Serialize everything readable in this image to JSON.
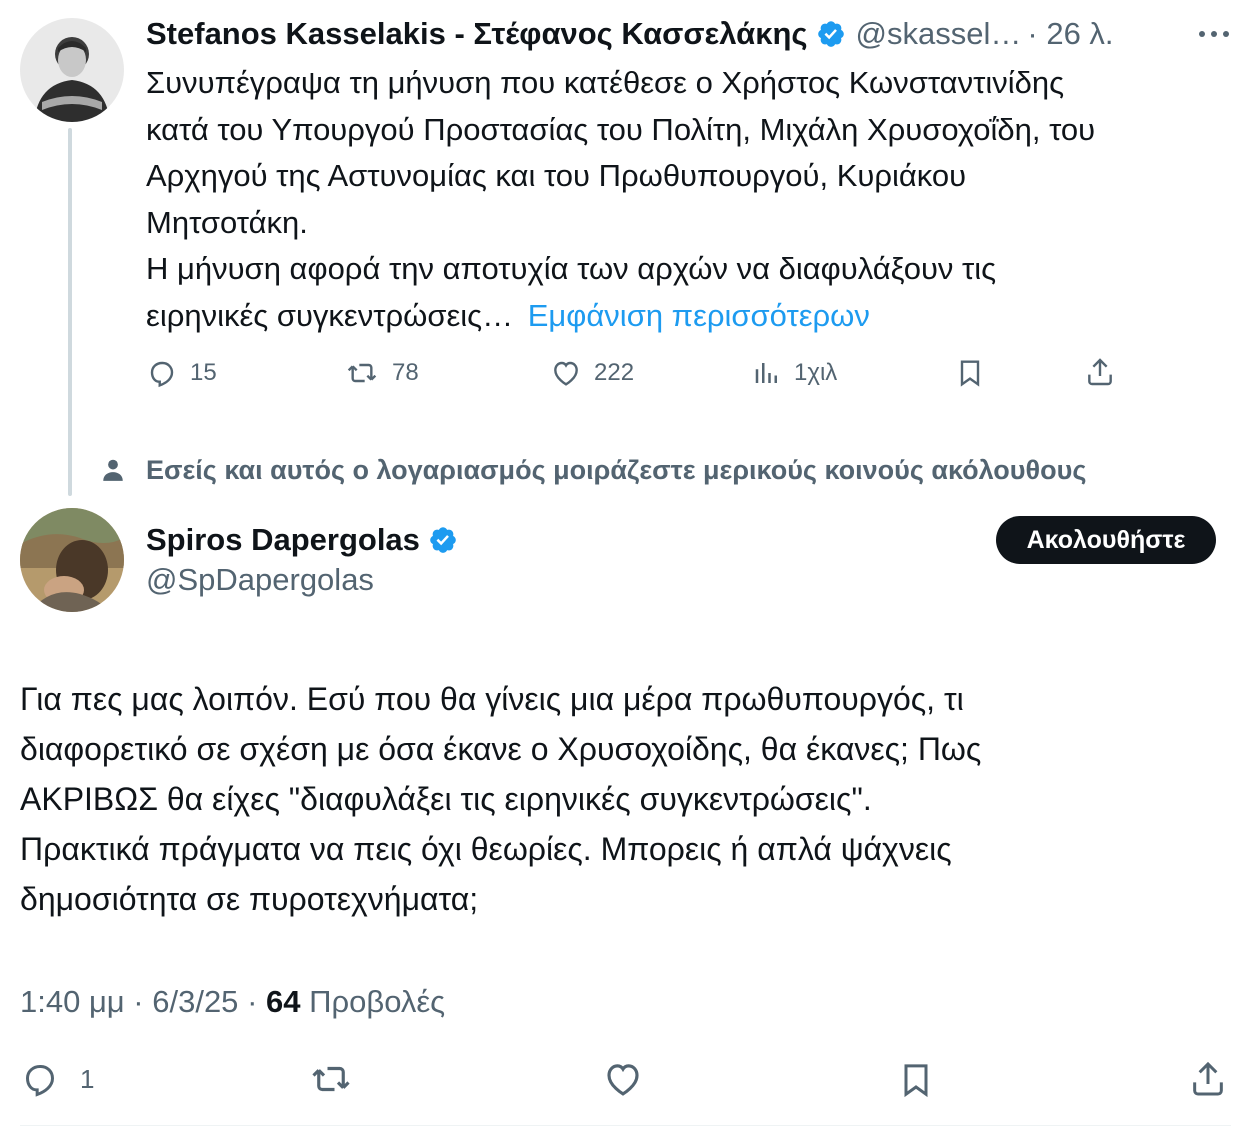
{
  "tweet1": {
    "author_name": "Stefanos Kasselakis - Στέφανος Κασσελάκης",
    "handle": "@skassel…",
    "time": "· 26 λ.",
    "more_icon": "more-horizontal-icon",
    "text_lines": [
      "Συνυπέγραψα τη μήνυση που κατέθεσε ο Χρήστος Κωνσταντινίδης",
      "κατά του Υπουργού Προστασίας του Πολίτη, Μιχάλη Χρυσοχοΐδη, του",
      "Αρχηγού της Αστυνομίας και του Πρωθυπουργού, Κυριάκου",
      "Μητσοτάκη.",
      "Η μήνυση αφορά την αποτυχία των αρχών να διαφυλάξουν τις"
    ],
    "last_line": "ειρηνικές συγκεντρώσεις…",
    "show_more": "Εμφάνιση περισσότερων",
    "replies": "15",
    "retweets": "78",
    "likes": "222",
    "views": "1χιλ"
  },
  "social_context": "Εσείς και αυτός ο λογαριασμός μοιράζεστε μερικούς κοινούς ακόλουθους",
  "tweet2": {
    "author_name": "Spiros Dapergolas",
    "handle": "@SpDapergolas",
    "follow_label": "Ακολουθήστε",
    "text_lines": [
      "Για πες μας λοιπόν. Εσύ που θα γίνεις μια μέρα πρωθυπουργός, τι",
      "διαφορετικό σε σχέση με όσα έκανε ο Χρυσοχοίδης, θα έκανες; Πως",
      "ΑΚΡΙΒΩΣ θα είχες \"διαφυλάξει τις ειρηνικές συγκεντρώσεις\".",
      "Πρακτικά πράγματα να πεις όχι θεωρίες. Μπορεις ή απλά ψάχνεις",
      "δημοσιότητα σε πυροτεχνήματα;"
    ],
    "time": "1:40 μμ",
    "date": "6/3/25",
    "views_count": "64",
    "views_label": "Προβολές",
    "replies": "1"
  },
  "colors": {
    "text": "#0f1419",
    "secondary": "#536471",
    "link": "#1d9bf0",
    "verified": "#1d9bf0",
    "button": "#0f1419"
  }
}
